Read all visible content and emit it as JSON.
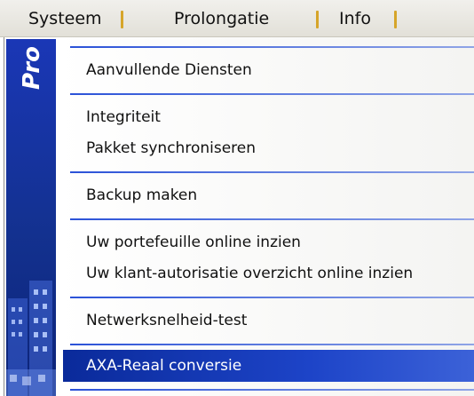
{
  "menubar": {
    "items": [
      {
        "label": "Systeem"
      },
      {
        "label": "Prolongatie"
      },
      {
        "label": "Info"
      }
    ]
  },
  "dropdown": {
    "sidebar_label": "Pro",
    "groups": [
      {
        "items": [
          {
            "label": "Aanvullende Diensten"
          }
        ]
      },
      {
        "items": [
          {
            "label": "Integriteit"
          },
          {
            "label": "Pakket synchroniseren"
          }
        ]
      },
      {
        "items": [
          {
            "label": "Backup maken"
          }
        ]
      },
      {
        "items": [
          {
            "label": "Uw portefeuille online inzien"
          },
          {
            "label": "Uw klant-autorisatie overzicht online inzien"
          }
        ]
      },
      {
        "items": [
          {
            "label": "Netwerksnelheid-test"
          }
        ]
      },
      {
        "items": [
          {
            "label": "AXA-Reaal conversie",
            "selected": true
          }
        ]
      }
    ]
  },
  "colors": {
    "accent": "#1d44c8",
    "sidebar": "#13318f",
    "separator": "#d6a52a"
  }
}
